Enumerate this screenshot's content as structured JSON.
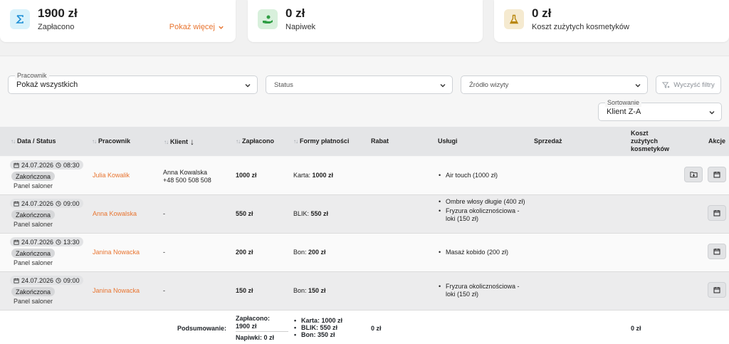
{
  "cards": {
    "paid": {
      "amount": "1900 zł",
      "label": "Zapłacono",
      "more": "Pokaż więcej",
      "color": "#d9f2fb"
    },
    "tip": {
      "amount": "0 zł",
      "label": "Napiwek",
      "color": "#d8f0dc"
    },
    "cosmetics": {
      "amount": "0 zł",
      "label": "Koszt zużytych kosmetyków",
      "color": "#f5ead0"
    }
  },
  "filters": {
    "employee": {
      "legend": "Pracownik",
      "value": "Pokaż wszystkich"
    },
    "status": {
      "placeholder": "Status"
    },
    "source": {
      "placeholder": "Źródło wizyty"
    },
    "clear": "Wyczyść filtry",
    "sort": {
      "legend": "Sortowanie",
      "value": "Klient Z-A"
    }
  },
  "table": {
    "headers": {
      "date": "Data / Status",
      "employee": "Pracownik",
      "client": "Klient",
      "paid": "Zapłacono",
      "payment": "Formy płatności",
      "discount": "Rabat",
      "services": "Usługi",
      "sale": "Sprzedaż",
      "cost_1": "Koszt",
      "cost_2": "zużytych",
      "cost_3": "kosmetyków",
      "actions": "Akcje"
    },
    "rows": [
      {
        "date": "24.07.2026",
        "time": "08:30",
        "status": "Zakończona",
        "source": "Panel saloner",
        "employee": "Julia Kowalik",
        "client_name": "Anna Kowalska",
        "client_phone": "+48 500 508 508",
        "paid": "1000 zł",
        "pay_method": "Karta:",
        "pay_amount": "1000 zł",
        "services": [
          "Air touch (1000 zł)"
        ]
      },
      {
        "date": "24.07.2026",
        "time": "09:00",
        "status": "Zakończona",
        "source": "Panel saloner",
        "employee": "Anna Kowalska",
        "client_name": "-",
        "paid": "550 zł",
        "pay_method": "BLIK:",
        "pay_amount": "550 zł",
        "services": [
          "Ombre włosy długie (400 zł)",
          "Fryzura okolicznościowa - loki (150 zł)"
        ]
      },
      {
        "date": "24.07.2026",
        "time": "13:30",
        "status": "Zakończona",
        "source": "Panel saloner",
        "employee": "Janina Nowacka",
        "client_name": "-",
        "paid": "200 zł",
        "pay_method": "Bon:",
        "pay_amount": "200 zł",
        "services": [
          "Masaż kobido (200 zł)"
        ]
      },
      {
        "date": "24.07.2026",
        "time": "09:00",
        "status": "Zakończona",
        "source": "Panel saloner",
        "employee": "Janina Nowacka",
        "client_name": "-",
        "paid": "150 zł",
        "pay_method": "Bon:",
        "pay_amount": "150 zł",
        "services": [
          "Fryzura okolicznościowa - loki (150 zł)"
        ]
      }
    ],
    "summary": {
      "label": "Podsumowanie:",
      "paid_1": "Zapłacono:",
      "paid_2": "1900 zł",
      "tips": "Napiwki: 0 zł",
      "payments": [
        "Karta: 1000 zł",
        "BLIK: 550 zł",
        "Bon: 350 zł"
      ],
      "discount": "0 zł",
      "cost": "0 zł"
    }
  }
}
